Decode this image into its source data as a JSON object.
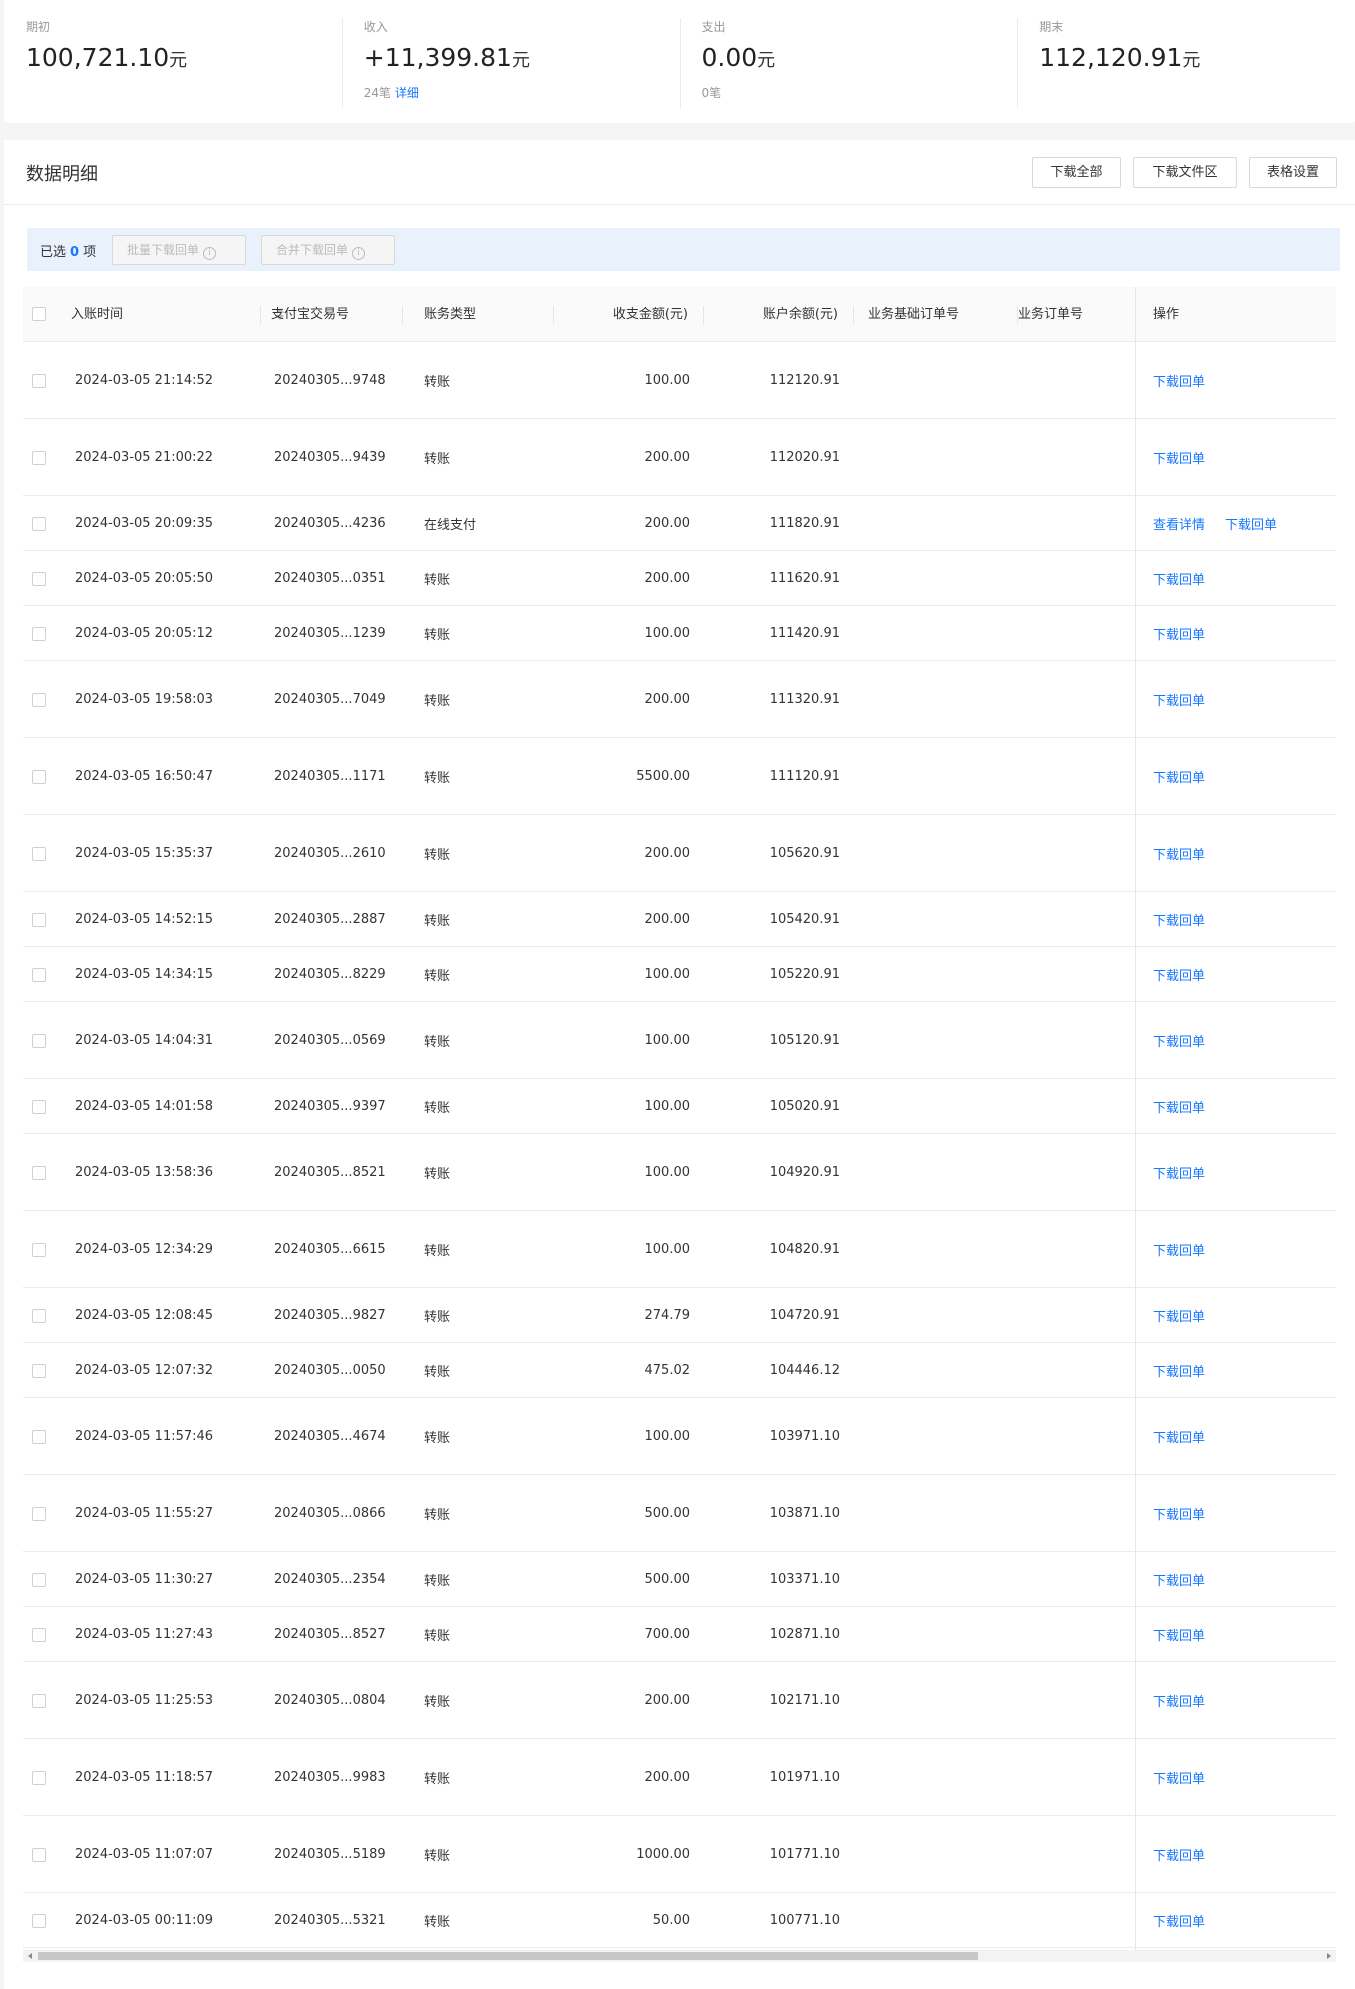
{
  "summary": {
    "opening": {
      "label": "期初",
      "amount": "100,721.10",
      "unit": "元"
    },
    "income": {
      "label": "收入",
      "amount": "+11,399.81",
      "unit": "元",
      "count": "24笔",
      "detail_link": "详细"
    },
    "expense": {
      "label": "支出",
      "amount": "0.00",
      "unit": "元",
      "count": "0笔"
    },
    "closing": {
      "label": "期末",
      "amount": "112,120.91",
      "unit": "元"
    }
  },
  "panel": {
    "title": "数据明细",
    "buttons": {
      "download_all": "下载全部",
      "download_area": "下载文件区",
      "table_settings": "表格设置"
    }
  },
  "selection": {
    "prefix": "已选",
    "count": "0",
    "suffix": "项",
    "batch_download": "批量下载回单",
    "merge_download": "合并下载回单"
  },
  "table": {
    "columns": {
      "time": "入账时间",
      "trade_no": "支付宝交易号",
      "type": "账务类型",
      "amount": "收支金额(元)",
      "balance": "账户余额(元)",
      "base_order": "业务基础订单号",
      "order": "业务订单号",
      "action": "操作"
    },
    "action_labels": {
      "download": "下载回单",
      "view": "查看详情"
    },
    "rows": [
      {
        "time": "2024-03-05 21:14:52",
        "trade_no": "20240305...9748",
        "type": "转账",
        "amount": "100.00",
        "balance": "112120.91"
      },
      {
        "time": "2024-03-05 21:00:22",
        "trade_no": "20240305...9439",
        "type": "转账",
        "amount": "200.00",
        "balance": "112020.91"
      },
      {
        "time": "2024-03-05 20:09:35",
        "trade_no": "20240305...4236",
        "type": "在线支付",
        "amount": "200.00",
        "balance": "111820.91",
        "view": true
      },
      {
        "time": "2024-03-05 20:05:50",
        "trade_no": "20240305...0351",
        "type": "转账",
        "amount": "200.00",
        "balance": "111620.91"
      },
      {
        "time": "2024-03-05 20:05:12",
        "trade_no": "20240305...1239",
        "type": "转账",
        "amount": "100.00",
        "balance": "111420.91"
      },
      {
        "time": "2024-03-05 19:58:03",
        "trade_no": "20240305...7049",
        "type": "转账",
        "amount": "200.00",
        "balance": "111320.91"
      },
      {
        "time": "2024-03-05 16:50:47",
        "trade_no": "20240305...1171",
        "type": "转账",
        "amount": "5500.00",
        "balance": "111120.91"
      },
      {
        "time": "2024-03-05 15:35:37",
        "trade_no": "20240305...2610",
        "type": "转账",
        "amount": "200.00",
        "balance": "105620.91"
      },
      {
        "time": "2024-03-05 14:52:15",
        "trade_no": "20240305...2887",
        "type": "转账",
        "amount": "200.00",
        "balance": "105420.91"
      },
      {
        "time": "2024-03-05 14:34:15",
        "trade_no": "20240305...8229",
        "type": "转账",
        "amount": "100.00",
        "balance": "105220.91"
      },
      {
        "time": "2024-03-05 14:04:31",
        "trade_no": "20240305...0569",
        "type": "转账",
        "amount": "100.00",
        "balance": "105120.91"
      },
      {
        "time": "2024-03-05 14:01:58",
        "trade_no": "20240305...9397",
        "type": "转账",
        "amount": "100.00",
        "balance": "105020.91"
      },
      {
        "time": "2024-03-05 13:58:36",
        "trade_no": "20240305...8521",
        "type": "转账",
        "amount": "100.00",
        "balance": "104920.91"
      },
      {
        "time": "2024-03-05 12:34:29",
        "trade_no": "20240305...6615",
        "type": "转账",
        "amount": "100.00",
        "balance": "104820.91"
      },
      {
        "time": "2024-03-05 12:08:45",
        "trade_no": "20240305...9827",
        "type": "转账",
        "amount": "274.79",
        "balance": "104720.91"
      },
      {
        "time": "2024-03-05 12:07:32",
        "trade_no": "20240305...0050",
        "type": "转账",
        "amount": "475.02",
        "balance": "104446.12"
      },
      {
        "time": "2024-03-05 11:57:46",
        "trade_no": "20240305...4674",
        "type": "转账",
        "amount": "100.00",
        "balance": "103971.10"
      },
      {
        "time": "2024-03-05 11:55:27",
        "trade_no": "20240305...0866",
        "type": "转账",
        "amount": "500.00",
        "balance": "103871.10"
      },
      {
        "time": "2024-03-05 11:30:27",
        "trade_no": "20240305...2354",
        "type": "转账",
        "amount": "500.00",
        "balance": "103371.10"
      },
      {
        "time": "2024-03-05 11:27:43",
        "trade_no": "20240305...8527",
        "type": "转账",
        "amount": "700.00",
        "balance": "102871.10"
      },
      {
        "time": "2024-03-05 11:25:53",
        "trade_no": "20240305...0804",
        "type": "转账",
        "amount": "200.00",
        "balance": "102171.10"
      },
      {
        "time": "2024-03-05 11:18:57",
        "trade_no": "20240305...9983",
        "type": "转账",
        "amount": "200.00",
        "balance": "101971.10"
      },
      {
        "time": "2024-03-05 11:07:07",
        "trade_no": "20240305...5189",
        "type": "转账",
        "amount": "1000.00",
        "balance": "101771.10"
      },
      {
        "time": "2024-03-05 00:11:09",
        "trade_no": "20240305...5321",
        "type": "转账",
        "amount": "50.00",
        "balance": "100771.10"
      }
    ]
  },
  "colors": {
    "accent": "#1677ff",
    "selection_bar": "#e8f1fc",
    "border": "#ebebeb"
  }
}
